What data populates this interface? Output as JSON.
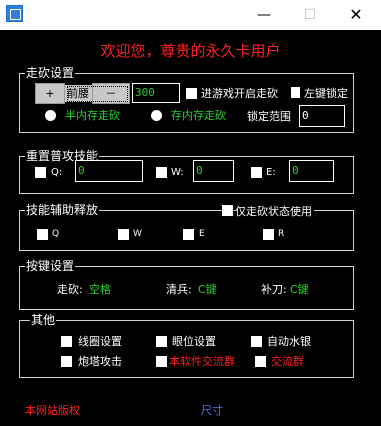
{
  "window": {
    "minimize_glyph": "—",
    "maximize_glyph": "☐",
    "close_glyph": "✕"
  },
  "welcome": "欢迎您，尊贵的永久卡用户",
  "walk": {
    "title": "走砍设置",
    "plus": "+",
    "preset": "前腰",
    "minus": "－",
    "speed_value": "300",
    "auto_on_enter": "进游戏开启走砍",
    "left_lock": "左键锁定",
    "half_mem": "半内存走砍",
    "in_mem": "存内存走砍",
    "lock_range_label": "锁定范围",
    "lock_range_value": "0"
  },
  "reset": {
    "title": "重置普攻技能",
    "q_label": "Q:",
    "q_value": "0",
    "w_label": "W:",
    "w_value": "0",
    "e_label": "E:",
    "e_value": "0"
  },
  "assist": {
    "title": "技能辅助释放",
    "only_walk": "仅走砍状态使用",
    "q": "Q",
    "w": "W",
    "e": "E",
    "r": "R"
  },
  "keys": {
    "title": "按键设置",
    "walk_label": "走砍:",
    "walk_value": "空格",
    "clear_label": "清兵:",
    "clear_value": "C键",
    "fill_label": "补刀:",
    "fill_value": "C键"
  },
  "other": {
    "title": "其他",
    "range_circle": "线圈设置",
    "eye": "眼位设置",
    "auto_water": "自动水银",
    "tower": "炮塔攻击",
    "software_group": "本软件交流群",
    "exchange_group": "交流群"
  },
  "footer": {
    "copyright": "本网站版权",
    "size": "尺寸"
  },
  "colors": {
    "accent_red": "#ff2020",
    "value_green": "#29d129",
    "link_blue": "#4a78e8"
  }
}
